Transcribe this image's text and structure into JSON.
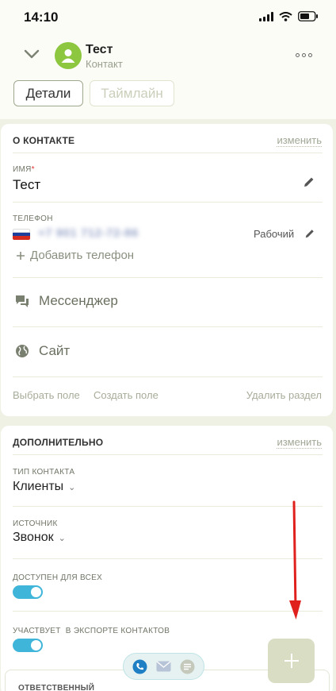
{
  "status_bar": {
    "time": "14:10"
  },
  "header": {
    "title": "Тест",
    "subtitle": "Контакт"
  },
  "tabs": [
    {
      "label": "Детали"
    },
    {
      "label": "Таймлайн"
    }
  ],
  "about": {
    "title": "О КОНТАКТЕ",
    "edit_label": "изменить",
    "name_label": "ИМЯ",
    "name_required": "*",
    "name_value": "Тест",
    "phone_label": "ТЕЛЕФОН",
    "phone_value": "+7 901 712-72-86",
    "phone_type": "Рабочий",
    "add_phone": "Добавить телефон",
    "messenger": "Мессенджер",
    "site": "Сайт",
    "select_field": "Выбрать поле",
    "create_field": "Создать поле",
    "delete_section": "Удалить раздел"
  },
  "additional": {
    "title": "ДОПОЛНИТЕЛЬНО",
    "edit_label": "изменить",
    "contact_type_label": "ТИП КОНТАКТА",
    "contact_type_value": "Клиенты",
    "source_label": "ИСТОЧНИК",
    "source_value": "Звонок",
    "available_label": "ДОСТУПЕН ДЛЯ ВСЕХ",
    "available_on": true,
    "export_label": "УЧАСТВУЕТ  В ЭКСПОРТЕ КОНТАКТОВ",
    "export_on": true,
    "responsible_label": "ОТВЕТСТВЕННЫЙ"
  },
  "colors": {
    "avatar": "#8dc63f",
    "toggle_on": "#3fb5d9",
    "arrow": "#e0201c",
    "background": "#eef1e4"
  },
  "icons": [
    "chevron-down-icon",
    "user-icon",
    "more-icon",
    "pencil-icon",
    "plus-icon",
    "chat-icon",
    "globe-icon",
    "phone-icon",
    "mail-icon",
    "comment-icon"
  ]
}
